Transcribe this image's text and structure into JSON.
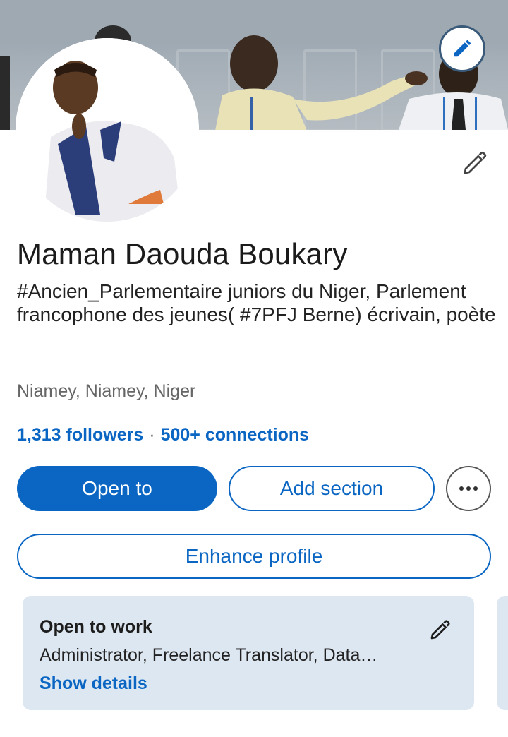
{
  "profile": {
    "name": "Maman Daouda Boukary",
    "headline": "#Ancien_Parlementaire juniors du Niger, Parlement francophone des jeunes( #7PFJ Berne) écrivain, poète",
    "location": "Niamey, Niamey, Niger",
    "followers": "1,313 followers",
    "separator": "·",
    "connections": "500+ connections"
  },
  "actions": {
    "open_to": "Open to",
    "add_section": "Add section",
    "more": "•••",
    "enhance_profile": "Enhance profile"
  },
  "open_to_work": {
    "title": "Open to work",
    "roles": "Administrator, Freelance Translator, Data…",
    "show_details": "Show details"
  },
  "icons": {
    "edit_cover": "pencil-icon",
    "edit_intro": "pencil-icon",
    "more": "more-horizontal-icon",
    "edit_open_to_work": "pencil-icon"
  },
  "colors": {
    "accent": "#0a66c2",
    "card_bg": "#dde7f1",
    "muted_text": "#666666"
  }
}
